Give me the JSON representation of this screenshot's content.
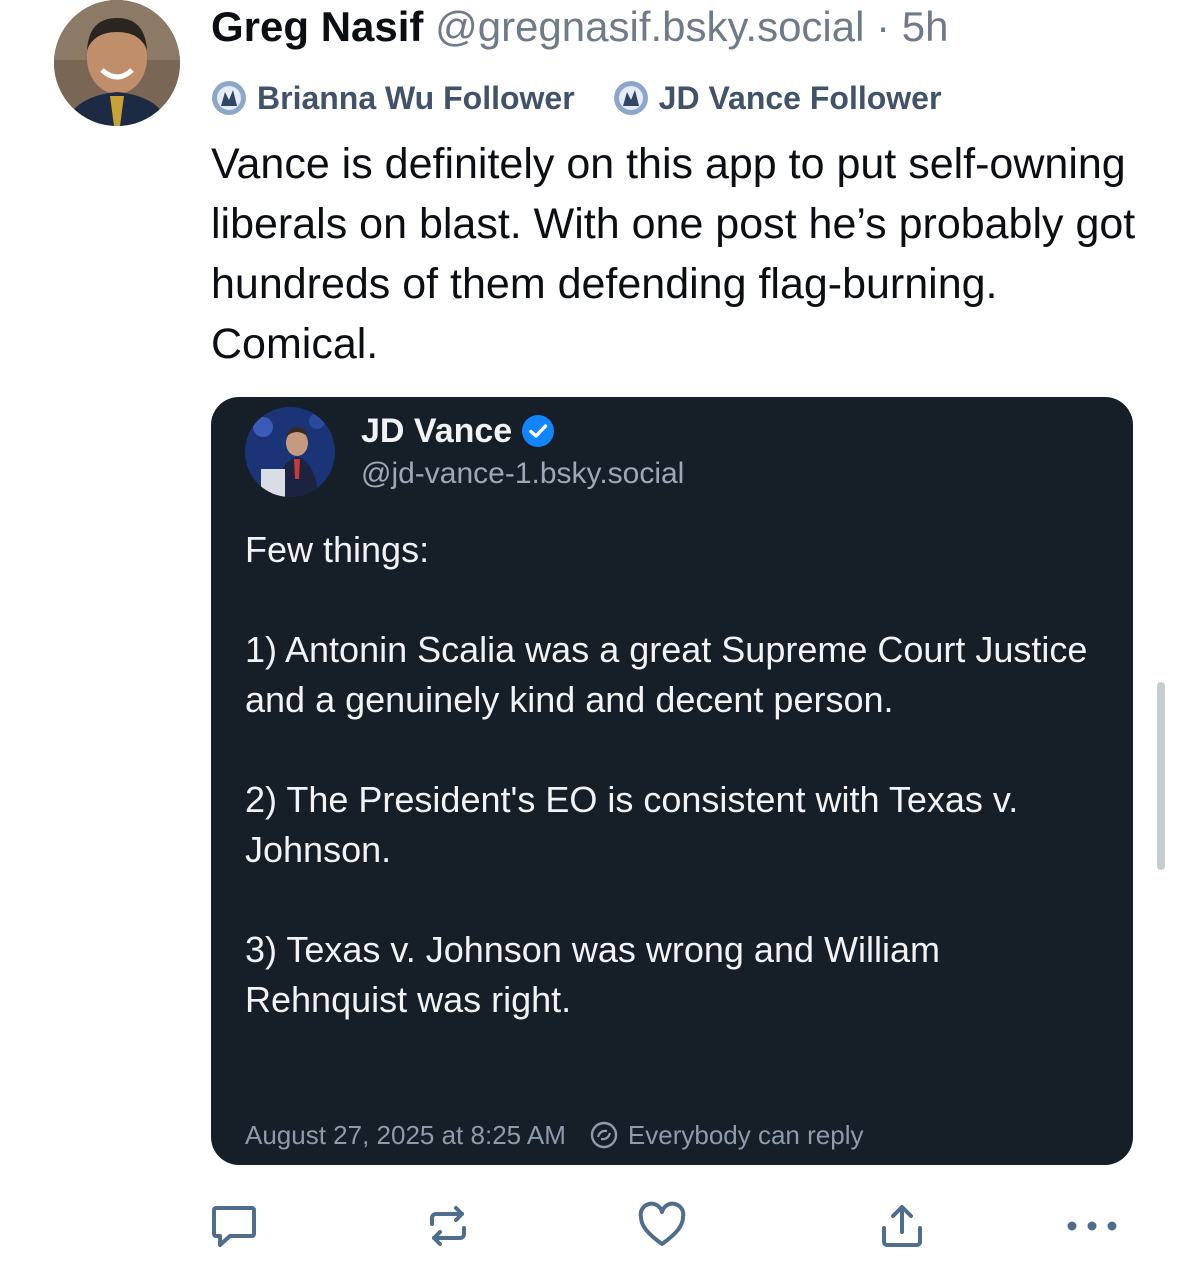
{
  "post": {
    "display_name": "Greg Nasif",
    "handle": "@gregnasif.bsky.social",
    "separator": "·",
    "time": "5h",
    "badges": [
      {
        "label": "Brianna Wu Follower",
        "icon": "follower-badge-icon"
      },
      {
        "label": "JD Vance Follower",
        "icon": "follower-badge-icon"
      }
    ],
    "text": "Vance is definitely on this app to put self-owning liberals on blast. With one post he’s probably got hundreds of them defending flag-burning. Comical."
  },
  "quote": {
    "display_name": "JD Vance",
    "handle": "@jd-vance-1.bsky.social",
    "verified": true,
    "paragraphs": [
      "Few things:",
      "1) Antonin Scalia was a great Supreme Court Justice and a genuinely kind and decent person.",
      "2) The President's EO is consistent with Texas v. Johnson.",
      "3) Texas v. Johnson was wrong and William Rehnquist was right."
    ],
    "timestamp": "August 27, 2025 at 8:25 AM",
    "reply_setting": "Everybody can reply"
  },
  "actions": {
    "icons": [
      "reply-icon",
      "repost-icon",
      "like-icon",
      "share-icon",
      "more-icon"
    ]
  },
  "colors": {
    "accent": "#1185fe",
    "quote_background": "#161e27",
    "muted_text": "#6f7b88",
    "badge_text": "#41536a"
  }
}
